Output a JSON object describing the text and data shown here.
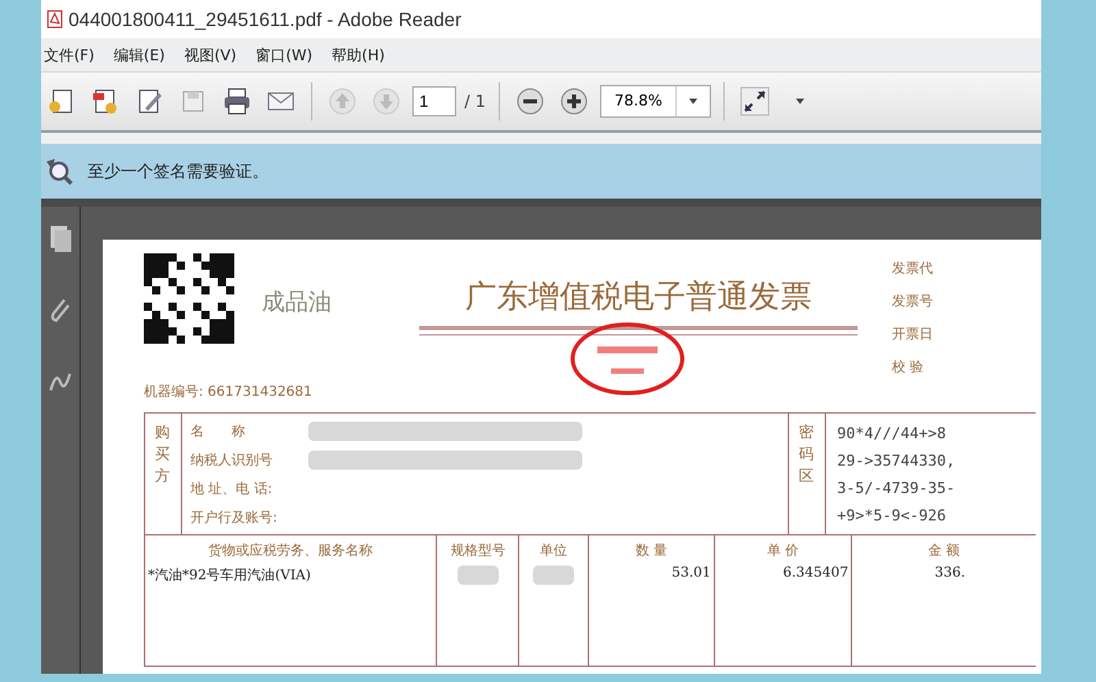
{
  "window": {
    "title": "044001800411_29451611.pdf - Adobe Reader"
  },
  "menu": [
    "文件(F)",
    "编辑(E)",
    "视图(V)",
    "窗口(W)",
    "帮助(H)"
  ],
  "toolbar": {
    "page_number": "1",
    "page_total": "/ 1",
    "zoom": "78.8%"
  },
  "message_bar": {
    "text": "至少一个签名需要验证。"
  },
  "invoice": {
    "category": "成品油",
    "title": "广东增值税电子普通发票",
    "machine_number": "机器编号: 661731432681",
    "header_fields": [
      "发票代",
      "发票号",
      "开票日",
      "校 验"
    ],
    "buyer_label": "购买方",
    "buyer_fields": [
      {
        "label": "名　　称",
        "blurred": true
      },
      {
        "label": "纳税人识别号",
        "blurred": true
      },
      {
        "label": "地 址、电 话:",
        "blurred": false
      },
      {
        "label": "开户行及账号:",
        "blurred": false
      }
    ],
    "cipher_label": "密码区",
    "cipher_lines": [
      "90*4///44+>8",
      "29->35744330,",
      "3-5/-4739-35-",
      "+9>*5-9<-926"
    ],
    "columns": [
      "货物或应税劳务、服务名称",
      "规格型号",
      "单位",
      "数 量",
      "单 价",
      "金 额"
    ],
    "rows": [
      {
        "name": "*汽油*92号车用汽油(VIA)",
        "quantity": "53.01",
        "unit_price": "6.345407",
        "amount": "336."
      }
    ]
  }
}
